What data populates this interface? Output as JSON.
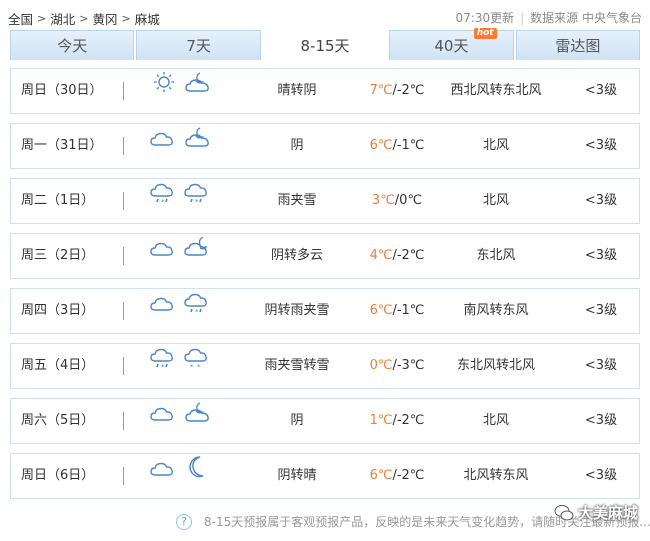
{
  "breadcrumb": {
    "items": [
      "全国",
      "湖北",
      "黄冈",
      "麻城"
    ],
    "separator": ">"
  },
  "meta": {
    "updated": "07:30更新",
    "source": "数据来源 中央气象台"
  },
  "tabs": [
    {
      "label": "今天",
      "active": false
    },
    {
      "label": "7天",
      "active": false
    },
    {
      "label": "8-15天",
      "active": true
    },
    {
      "label": "40天",
      "active": false,
      "badge": "hot"
    },
    {
      "label": "雷达图",
      "active": false
    }
  ],
  "days": [
    {
      "date": "周日（30日）",
      "icons": [
        "sun-icon",
        "cloud-moon-icon"
      ],
      "desc": "晴转阴",
      "high": "7℃",
      "low": "/-2℃",
      "wind": "西北风转东北风",
      "level": "<3级"
    },
    {
      "date": "周一（31日）",
      "icons": [
        "cloud-icon",
        "cloud-moon-icon"
      ],
      "desc": "阴",
      "high": "6℃",
      "low": "/-1℃",
      "wind": "北风",
      "level": "<3级"
    },
    {
      "date": "周二（1日）",
      "icons": [
        "sleet-icon",
        "sleet-icon"
      ],
      "desc": "雨夹雪",
      "high": "3℃",
      "low": "/0℃",
      "wind": "北风",
      "level": "<3级"
    },
    {
      "date": "周三（2日）",
      "icons": [
        "cloud-icon",
        "moon-cloud-icon"
      ],
      "desc": "阴转多云",
      "high": "4℃",
      "low": "/-2℃",
      "wind": "东北风",
      "level": "<3级"
    },
    {
      "date": "周四（3日）",
      "icons": [
        "cloud-icon",
        "sleet-icon"
      ],
      "desc": "阴转雨夹雪",
      "high": "6℃",
      "low": "/-1℃",
      "wind": "南风转东风",
      "level": "<3级"
    },
    {
      "date": "周五（4日）",
      "icons": [
        "sleet-icon",
        "snow-icon"
      ],
      "desc": "雨夹雪转雪",
      "high": "0℃",
      "low": "/-3℃",
      "wind": "东北风转北风",
      "level": "<3级"
    },
    {
      "date": "周六（5日）",
      "icons": [
        "cloud-icon",
        "cloud-moon-icon"
      ],
      "desc": "阴",
      "high": "1℃",
      "low": "/-2℃",
      "wind": "北风",
      "level": "<3级"
    },
    {
      "date": "周日（6日）",
      "icons": [
        "cloud-icon",
        "moon-icon"
      ],
      "desc": "阴转晴",
      "high": "6℃",
      "low": "/-2℃",
      "wind": "北风转东风",
      "level": "<3级"
    }
  ],
  "footer": {
    "help": "?",
    "note": "8-15天预报属于客观预报产品，反映的是未来天气变化趋势，请随时关注最新预报..."
  },
  "watermark": "大美麻城",
  "colors": {
    "high_temp": "#e8823a",
    "icon_blue": "#4a86c8",
    "tab_bg": "#d6e8f7"
  }
}
